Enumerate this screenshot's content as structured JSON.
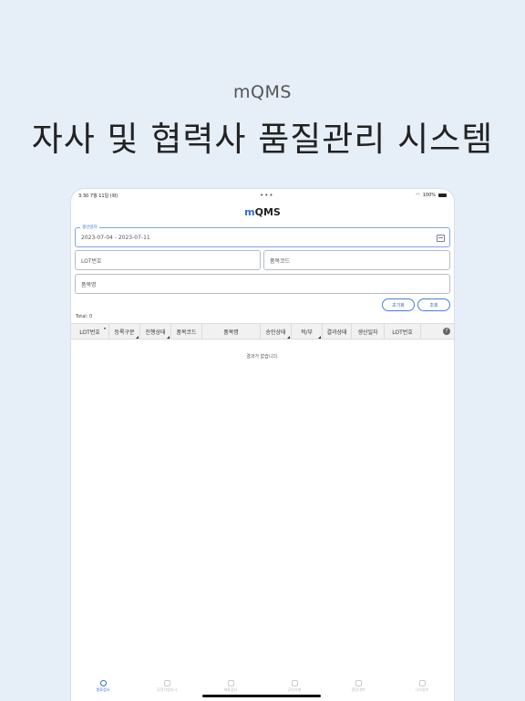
{
  "promo": {
    "subtitle": "mQMS",
    "title": "자사 및 협력사 품질관리 시스템"
  },
  "status_bar": {
    "time_date": "3:30  7월 11일 (화)",
    "battery_text": "100%"
  },
  "app": {
    "title_prefix": "m",
    "title_rest": "QMS"
  },
  "form": {
    "date_label": "생산일자",
    "date_value": "2023-07-04 - 2023-07-11",
    "lot_placeholder": "LOT번호",
    "item_code_placeholder": "품목코드",
    "item_name_placeholder": "품목명",
    "reset_label": "초기화",
    "search_label": "조회"
  },
  "results": {
    "total": "Total: 0",
    "empty_message": "결과가 없습니다."
  },
  "table": {
    "columns": [
      "LOT번호",
      "등록구분",
      "진행상태",
      "품목코드",
      "품목명",
      "승인상태",
      "적/부",
      "결과상태",
      "생산일자",
      "LOT번호"
    ],
    "help": "?"
  },
  "tabbar": {
    "items": [
      {
        "label": "원료검사"
      },
      {
        "label": "공정작업지시"
      },
      {
        "label": "제품검사"
      },
      {
        "label": "공지사항"
      },
      {
        "label": "알림내역"
      },
      {
        "label": "나의정보"
      }
    ]
  },
  "colors": {
    "accent": "#2f6fd6",
    "background": "#e6eef8"
  }
}
